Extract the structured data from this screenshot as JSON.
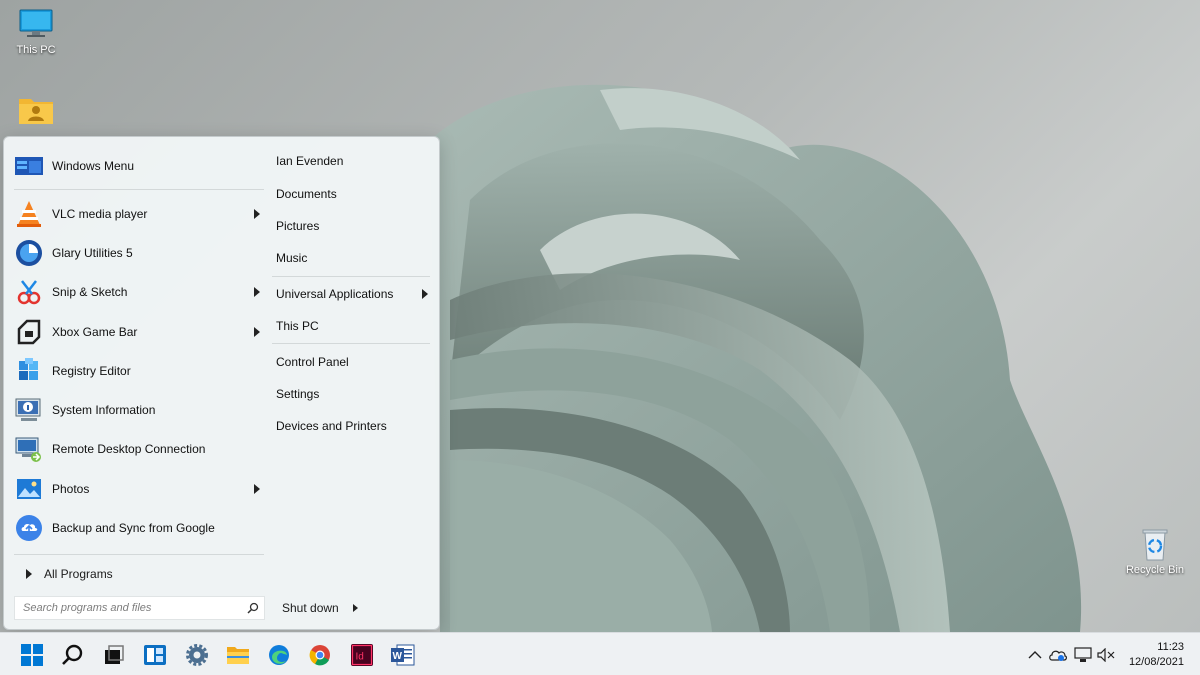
{
  "desktop": {
    "icons": [
      {
        "label": "This PC",
        "icon": "monitor-icon"
      },
      {
        "label": "",
        "icon": "user-folder-icon"
      },
      {
        "label": "Recycle Bin",
        "icon": "recycle-bin-icon"
      }
    ]
  },
  "start_menu": {
    "pinned": [
      {
        "label": "Windows Menu",
        "icon": "windows-menu-icon",
        "submenu": false
      },
      {
        "label": "VLC media player",
        "icon": "vlc-icon",
        "submenu": true
      },
      {
        "label": "Glary Utilities 5",
        "icon": "glary-icon",
        "submenu": false
      },
      {
        "label": "Snip & Sketch",
        "icon": "snip-sketch-icon",
        "submenu": true
      },
      {
        "label": "Xbox Game Bar",
        "icon": "xbox-icon",
        "submenu": true
      },
      {
        "label": "Registry Editor",
        "icon": "registry-icon",
        "submenu": false
      },
      {
        "label": "System Information",
        "icon": "system-info-icon",
        "submenu": false
      },
      {
        "label": "Remote Desktop Connection",
        "icon": "remote-desktop-icon",
        "submenu": false
      },
      {
        "label": "Photos",
        "icon": "photos-icon",
        "submenu": true
      },
      {
        "label": "Backup and Sync from Google",
        "icon": "google-backup-icon",
        "submenu": false
      }
    ],
    "all_programs": "All Programs",
    "search_placeholder": "Search programs and files",
    "right": {
      "user": "Ian Evenden",
      "documents": "Documents",
      "pictures": "Pictures",
      "music": "Music",
      "universal_apps": "Universal Applications",
      "this_pc": "This PC",
      "control_panel": "Control Panel",
      "settings": "Settings",
      "devices": "Devices and Printers"
    },
    "shutdown": "Shut down"
  },
  "taskbar": {
    "apps": [
      "start-icon",
      "search-icon",
      "task-view-icon",
      "widgets-icon",
      "settings-icon",
      "file-explorer-icon",
      "edge-icon",
      "chrome-icon",
      "indesign-icon",
      "word-icon"
    ],
    "indesign_label": "Id",
    "word_label": "W",
    "tray": [
      "chevron-up-icon",
      "onedrive-icon",
      "network-icon",
      "volume-muted-icon"
    ],
    "time": "11:23",
    "date": "12/08/2021"
  },
  "colors": {
    "accent": "#0078d4",
    "menu_bg": "#f1f5f6",
    "taskbar_bg": "#eef1f3",
    "wallpaper": "#8fa59f"
  }
}
